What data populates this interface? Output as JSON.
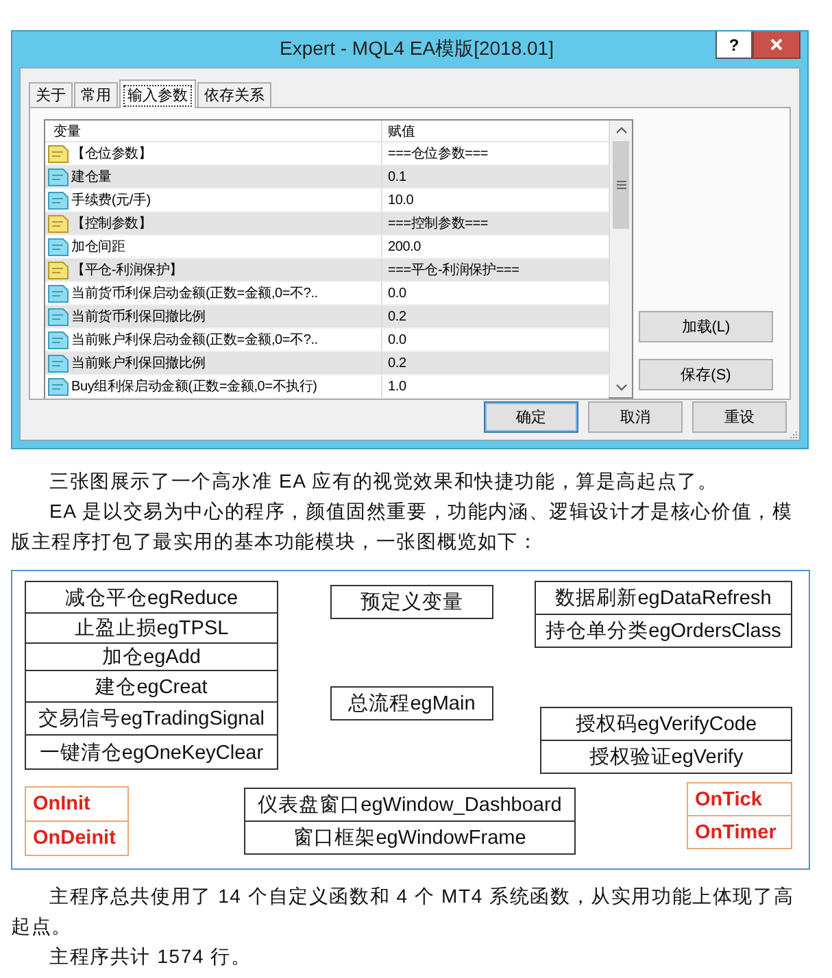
{
  "dialog": {
    "title": "Expert - MQL4 EA模版[2018.01]",
    "help_button": "?",
    "tabs": [
      {
        "label": "关于",
        "selected": false
      },
      {
        "label": "常用",
        "selected": false
      },
      {
        "label": "输入参数",
        "selected": true
      },
      {
        "label": "依存关系",
        "selected": false
      }
    ],
    "table": {
      "columns": [
        "变量",
        "赋值"
      ],
      "rows": [
        {
          "kind": "string",
          "name": "【仓位参数】",
          "value": "===仓位参数==="
        },
        {
          "kind": "number",
          "name": "建仓量",
          "value": "0.1"
        },
        {
          "kind": "number",
          "name": "手续费(元/手)",
          "value": "10.0"
        },
        {
          "kind": "string",
          "name": "【控制参数】",
          "value": "===控制参数==="
        },
        {
          "kind": "number",
          "name": "加仓间距",
          "value": "200.0"
        },
        {
          "kind": "string",
          "name": "【平仓-利润保护】",
          "value": "===平仓-利润保护==="
        },
        {
          "kind": "number",
          "name": "当前货币利保启动金额(正数=金额,0=不?..",
          "value": "0.0"
        },
        {
          "kind": "number",
          "name": "当前货币利保回撤比例",
          "value": "0.2"
        },
        {
          "kind": "number",
          "name": "当前账户利保启动金额(正数=金额,0=不?..",
          "value": "0.0"
        },
        {
          "kind": "number",
          "name": "当前账户利保回撤比例",
          "value": "0.2"
        },
        {
          "kind": "number",
          "name": "Buy组利保启动金额(正数=金额,0=不执行)",
          "value": "1.0"
        }
      ]
    },
    "side_buttons": [
      "加载(L)",
      "保存(S)"
    ],
    "buttons": [
      {
        "label": "确定",
        "default": true
      },
      {
        "label": "取消",
        "default": false
      },
      {
        "label": "重设",
        "default": false
      }
    ]
  },
  "paragraphs_top": [
    "三张图展示了一个高水准 EA 应有的视觉效果和快捷功能，算是高起点了。",
    "EA 是以交易为中心的程序，颜值固然重要，功能内涵、逻辑设计才是核心价值，模版主程序打包了最实用的基本功能模块，一张图概览如下："
  ],
  "diagram": {
    "groups": [
      {
        "kind": "module",
        "items": [
          "减仓平仓egReduce",
          "止盈止损egTPSL",
          "加仓egAdd",
          "建仓egCreat",
          "交易信号egTradingSignal",
          "一键清仓egOneKeyClear"
        ]
      },
      {
        "kind": "module",
        "items": [
          "预定义变量"
        ]
      },
      {
        "kind": "module",
        "items": [
          "数据刷新egDataRefresh",
          "持仓单分类egOrdersClass"
        ]
      },
      {
        "kind": "module",
        "items": [
          "总流程egMain"
        ]
      },
      {
        "kind": "module",
        "items": [
          "授权码egVerifyCode",
          "授权验证egVerify"
        ]
      },
      {
        "kind": "event",
        "items": [
          "OnInit",
          "OnDeinit"
        ]
      },
      {
        "kind": "module",
        "items": [
          "仪表盘窗口egWindow_Dashboard",
          "窗口框架egWindowFrame"
        ]
      },
      {
        "kind": "event",
        "items": [
          "OnTick",
          "OnTimer"
        ]
      }
    ]
  },
  "paragraphs_bottom": [
    "主程序总共使用了 14 个自定义函数和 4 个 MT4 系统函数，从实用功能上体现了高起点。",
    "主程序共计 1574 行。"
  ]
}
